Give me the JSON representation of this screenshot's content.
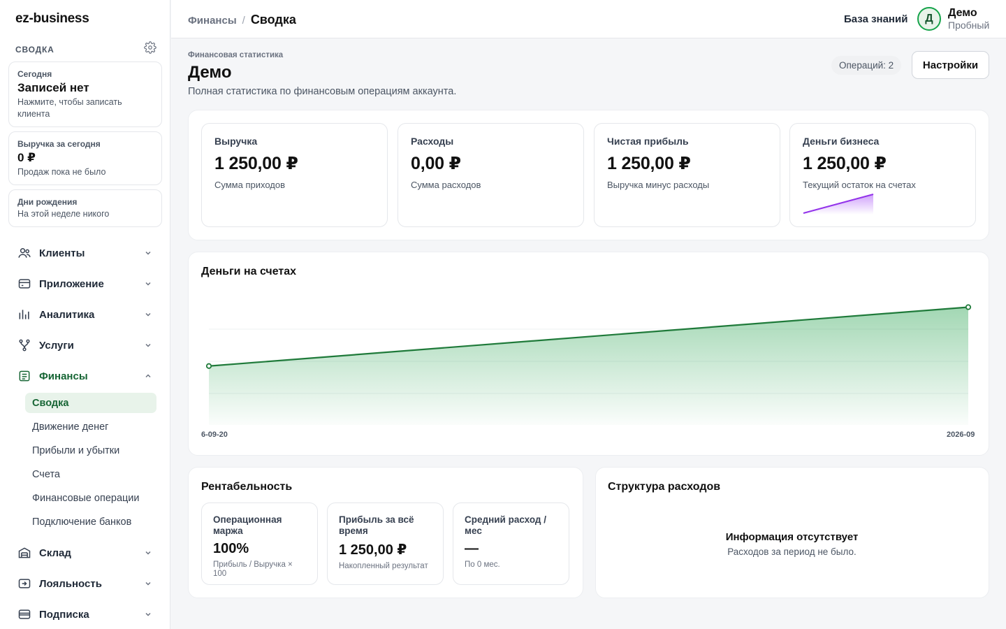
{
  "app": {
    "brand": "ez-business"
  },
  "sidebar": {
    "section_title": "СВОДКА",
    "cards": [
      {
        "label": "Сегодня",
        "title": "Записей нет",
        "sub": "Нажмите, чтобы записать клиента"
      },
      {
        "label": "Выручка за сегодня",
        "title": "0 ₽",
        "sub": "Продаж пока не было"
      },
      {
        "label": "Дни рождения",
        "sub": "На этой неделе никого"
      }
    ],
    "nav": [
      {
        "label": "Клиенты",
        "icon": "users-icon"
      },
      {
        "label": "Приложение",
        "icon": "card-icon"
      },
      {
        "label": "Аналитика",
        "icon": "bar-chart-icon"
      },
      {
        "label": "Услуги",
        "icon": "branch-icon"
      },
      {
        "label": "Финансы",
        "icon": "document-icon",
        "expanded": true
      },
      {
        "label": "Склад",
        "icon": "warehouse-icon"
      },
      {
        "label": "Лояльность",
        "icon": "loyalty-icon"
      },
      {
        "label": "Подписка",
        "icon": "credit-card-icon"
      }
    ],
    "finance_sub": [
      "Сводка",
      "Движение денег",
      "Прибыли и убытки",
      "Счета",
      "Финансовые операции",
      "Подключение банков"
    ],
    "finance_current": "Сводка"
  },
  "header": {
    "breadcrumb_parent": "Финансы",
    "breadcrumb_sep": "/",
    "breadcrumb_current": "Сводка",
    "knowledge_base": "База знаний",
    "user_initial": "Д",
    "user_name": "Демо",
    "user_plan": "Пробный"
  },
  "page": {
    "kicker": "Финансовая статистика",
    "title": "Демо",
    "description": "Полная статистика по финансовым операциям аккаунта.",
    "operations_badge": "Операций: 2",
    "settings_button": "Настройки"
  },
  "kpis": [
    {
      "label": "Выручка",
      "value": "1 250,00 ₽",
      "sub": "Сумма приходов"
    },
    {
      "label": "Расходы",
      "value": "0,00 ₽",
      "sub": "Сумма расходов"
    },
    {
      "label": "Чистая прибыль",
      "value": "1 250,00 ₽",
      "sub": "Выручка минус расходы"
    },
    {
      "label": "Деньги бизнеса",
      "value": "1 250,00 ₽",
      "sub": "Текущий остаток на счетах"
    }
  ],
  "sparkline_color": "#9333ea",
  "accent_color": "#166534",
  "chart_data": {
    "type": "area",
    "title": "Деньги на счетах",
    "x": [
      "6-09-20",
      "2026-09"
    ],
    "series": [
      {
        "values": [
          1,
          2
        ]
      }
    ],
    "grid": true,
    "legend": "none"
  },
  "profitability": {
    "title": "Рентабельность",
    "cards": [
      {
        "label": "Операционная маржа",
        "value": "100%",
        "sub": "Прибыль / Выручка × 100"
      },
      {
        "label": "Прибыль за всё время",
        "value": "1 250,00 ₽",
        "sub": "Накопленный результат"
      },
      {
        "label": "Средний расход / мес",
        "value": "—",
        "sub": "По 0 мес."
      }
    ]
  },
  "expenses": {
    "title": "Структура расходов",
    "empty_title": "Информация отсутствует",
    "empty_sub": "Расходов за период не было."
  }
}
